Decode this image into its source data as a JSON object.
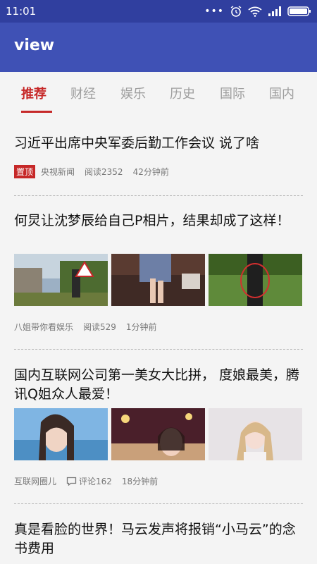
{
  "status_bar": {
    "time": "11:01"
  },
  "app_bar": {
    "title": "view"
  },
  "tabs": [
    "推荐",
    "财经",
    "娱乐",
    "历史",
    "国际",
    "国内"
  ],
  "articles": [
    {
      "title": "习近平出席中央军委后勤工作会议 说了啥",
      "badge": "置顶",
      "source": "央视新闻",
      "stat": "阅读2352",
      "time": "42分钟前"
    },
    {
      "title": "何炅让沈梦辰给自己P相片，结果却成了这样！",
      "source": "八姐带你看娱乐",
      "stat": "阅读529",
      "time": "1分钟前"
    },
    {
      "title": "国内互联网公司第一美女大比拼， 度娘最美，腾讯Q姐众人最爱！",
      "source": "互联网圈儿",
      "stat": "评论162",
      "time": "18分钟前"
    },
    {
      "title": "真是看脸的世界！马云发声将报销“小马云”的念书费用"
    }
  ]
}
